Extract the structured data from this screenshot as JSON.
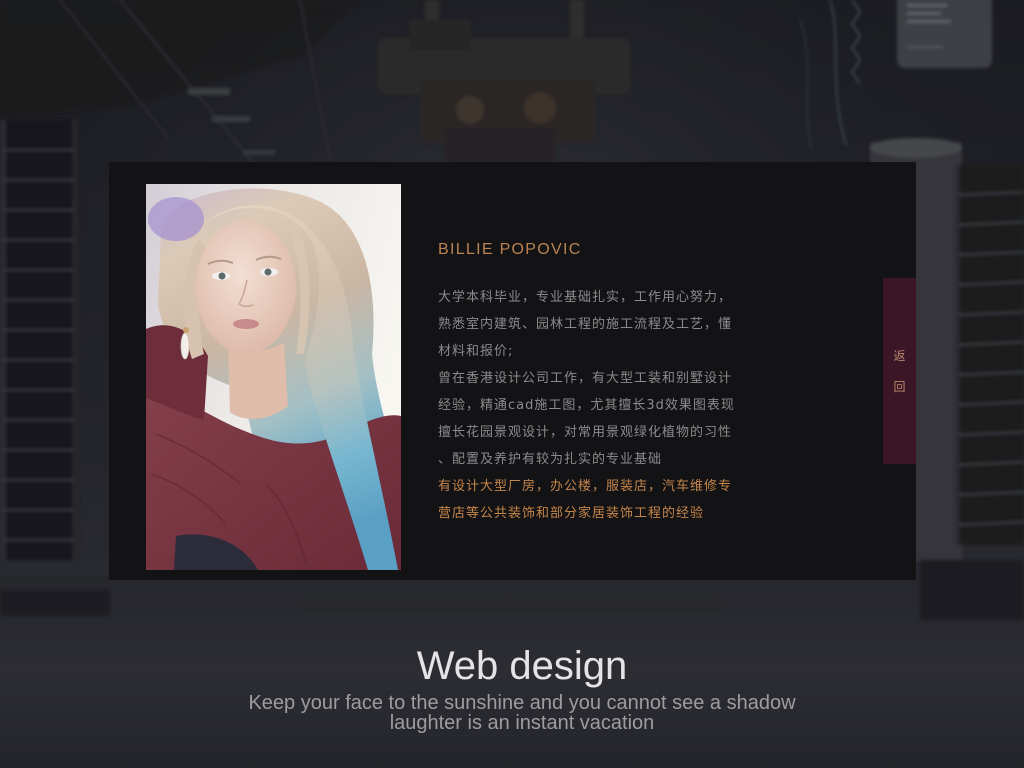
{
  "profile": {
    "name": "BILLIE POPOVIC",
    "bio_lines": [
      "大学本科毕业，专业基础扎实，工作用心努力，",
      "熟悉室内建筑、园林工程的施工流程及工艺，懂",
      "材料和报价;",
      "曾在香港设计公司工作，有大型工装和别墅设计",
      "经验，精通cad施工图，尤其擅长3d效果图表现",
      "擅长花园景观设计，对常用景观绿化植物的习性",
      "、配置及养护有较为扎实的专业基础"
    ],
    "highlight_lines": [
      "有设计大型厂房，办公楼，服装店，汽车维修专",
      "营店等公共装饰和部分家居装饰工程的经验"
    ]
  },
  "back_button": {
    "label_chars": [
      "返",
      "回"
    ]
  },
  "footer": {
    "title": "Web design",
    "tagline_lines": [
      "Keep your face to the sunshine and you cannot see a shadow",
      "laughter is an instant vacation"
    ]
  },
  "colors": {
    "page_background": "#202127",
    "panel_background": "#131214",
    "name_accent": "#bb8352",
    "body_text": "#8b8a8c",
    "highlight_text": "#c5864c",
    "back_button_bg": "#3b1626",
    "back_button_text": "#b98a6c",
    "title_text": "#e4e4e6",
    "tagline_text": "#9d9da1"
  }
}
